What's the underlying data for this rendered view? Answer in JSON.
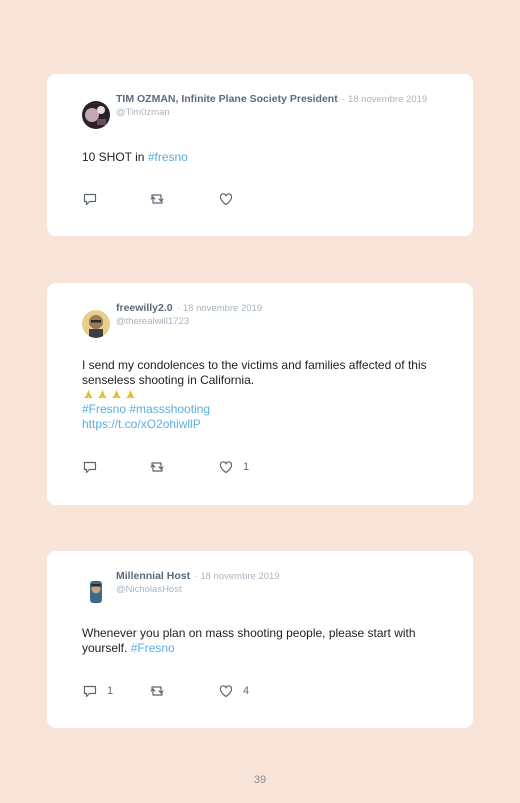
{
  "tweets": [
    {
      "name": "TIM OZMAN, Infinite Plane Society President",
      "date": "· 18 novembre 2019",
      "handle": "@Tim0zman",
      "text": "10 SHOT in ",
      "hashtags": "#fresno",
      "reply_count": "",
      "retweet_count": "",
      "like_count": ""
    },
    {
      "name": "freewilly2.0",
      "date": "· 18 novembre 2019",
      "handle": "@therealwill1723",
      "text": "I send my condolences to the victims and families affected of this senseless shooting in California.",
      "emoji": "🙏🙏🙏🙏",
      "hashtags": "#Fresno #massshooting",
      "link": "https://t.co/xO2ohiwllP",
      "reply_count": "",
      "retweet_count": "",
      "like_count": "1"
    },
    {
      "name": "Millennial Host",
      "date": "· 18 novembre 2019",
      "handle": "@NicholasHost",
      "text": "Whenever you plan on mass shooting people, please start with yourself. ",
      "hashtags": "#Fresno",
      "reply_count": "1",
      "retweet_count": "",
      "like_count": "4"
    }
  ],
  "icons": {
    "reply": "reply-icon",
    "retweet": "retweet-icon",
    "like": "heart-icon"
  },
  "colors": {
    "background": "#f9e4da",
    "card": "#ffffff",
    "hashtag": "#5aaee0"
  },
  "page_number": "39"
}
